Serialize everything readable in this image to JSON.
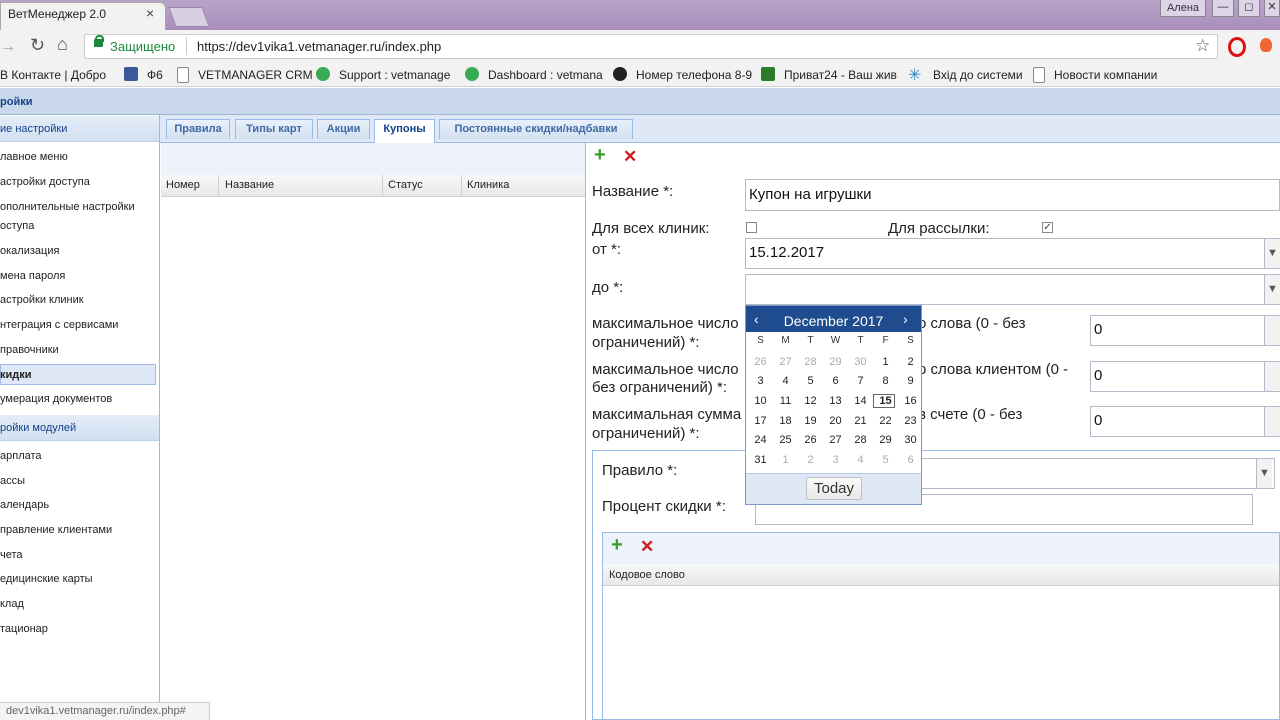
{
  "browser": {
    "tab_title": "ВетМенеджер 2.0",
    "tab_close": "×",
    "user_badge": "Алена",
    "win_min": "—",
    "win_max": "◻",
    "win_close": "✕",
    "secure_label": "Защищено",
    "url": "https://dev1vika1.vetmanager.ru/index.php",
    "status_url": "dev1vika1.vetmanager.ru/index.php#"
  },
  "bookmarks": [
    {
      "label": "В Контакте | Добро"
    },
    {
      "label": "Ф6"
    },
    {
      "label": "VETMANAGER CRM"
    },
    {
      "label": "Support : vetmanage"
    },
    {
      "label": "Dashboard : vetmana"
    },
    {
      "label": "Номер телефона 8-9"
    },
    {
      "label": "Приват24 - Ваш жив"
    },
    {
      "label": "Вхід до системи"
    },
    {
      "label": "Новости компании"
    }
  ],
  "app": {
    "header": "ройки"
  },
  "sidebar": {
    "group1": "ие настройки",
    "items1": [
      "лавное меню",
      "астройки доступа",
      "ополнительные настройки",
      "оступа",
      "окализация",
      "мена пароля",
      "астройки клиник",
      "нтеграция с сервисами",
      "правочники",
      "кидки",
      "умерация документов"
    ],
    "group2": "ройки модулей",
    "items2": [
      "арплата",
      "ассы",
      "алендарь",
      "правление клиентами",
      "чета",
      "едицинские карты",
      "клад",
      "тационар"
    ]
  },
  "tabs": [
    "Правила",
    "Типы карт",
    "Акции",
    "Купоны",
    "Постоянные скидки/надбавки"
  ],
  "grid": {
    "columns": [
      "Номер",
      "Название",
      "Статус",
      "Клиника"
    ]
  },
  "form": {
    "name_label": "Название *:",
    "name_value": "Купон на игрушки",
    "all_clinics_label": "Для всех клиник:",
    "mailing_label": "Для рассылки:",
    "from_label": "от *:",
    "from_value": "15.12.2017",
    "to_label": "до *:",
    "to_value": "",
    "max1_label_a": "максимальное число",
    "max1_label_b": "о слова (0 - без",
    "max1_label_c": "ограничений) *:",
    "max1_value": "0",
    "max2_label_a": "максимальное число",
    "max2_label_b": "о слова клиентом (0 -",
    "max2_label_c": "без ограничений) *:",
    "max2_value": "0",
    "max3_label_a": "максимальная сумма",
    "max3_label_b": "в счете (0 - без",
    "max3_label_c": "ограничений) *:",
    "max3_value": "0",
    "rule_label": "Правило *:",
    "percent_label": "Процент скидки *:",
    "codeword_header": "Кодовое слово"
  },
  "calendar": {
    "title": "December 2017",
    "prev": "‹",
    "next": "›",
    "dow": [
      "S",
      "M",
      "T",
      "W",
      "T",
      "F",
      "S"
    ],
    "weeks": [
      [
        "26",
        "27",
        "28",
        "29",
        "30",
        "1",
        "2"
      ],
      [
        "3",
        "4",
        "5",
        "6",
        "7",
        "8",
        "9"
      ],
      [
        "10",
        "11",
        "12",
        "13",
        "14",
        "15",
        "16"
      ],
      [
        "17",
        "18",
        "19",
        "20",
        "21",
        "22",
        "23"
      ],
      [
        "24",
        "25",
        "26",
        "27",
        "28",
        "29",
        "30"
      ],
      [
        "31",
        "1",
        "2",
        "3",
        "4",
        "5",
        "6"
      ]
    ],
    "selected": "15",
    "today_label": "Today"
  }
}
